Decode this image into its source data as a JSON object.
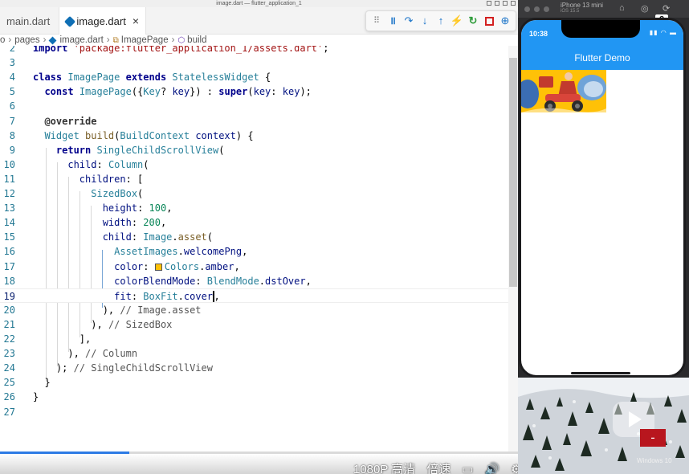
{
  "window": {
    "title": "image.dart — flutter_application_1"
  },
  "tabs": [
    {
      "label": "main.dart",
      "active": false
    },
    {
      "label": "image.dart",
      "active": true,
      "close_glyph": "×"
    }
  ],
  "breadcrumb": {
    "items": [
      "o",
      "pages",
      "image.dart",
      "ImagePage",
      "build"
    ],
    "separator": "›"
  },
  "debug_toolbar": {
    "icons": [
      "drag-handle-icon",
      "pause-icon",
      "step-over-icon",
      "step-into-icon",
      "step-out-icon",
      "hot-reload-icon",
      "restart-icon",
      "stop-icon",
      "devtools-icon"
    ]
  },
  "editor": {
    "current_line": 19,
    "lines": [
      {
        "n": "2",
        "tokens": [
          [
            "kw",
            "import "
          ],
          [
            "str",
            "'package:flutter_application_1/assets.dart'"
          ],
          [
            "plain",
            ";"
          ]
        ]
      },
      {
        "n": "3",
        "tokens": []
      },
      {
        "n": "4",
        "tokens": [
          [
            "kw",
            "class "
          ],
          [
            "type",
            "ImagePage "
          ],
          [
            "kw",
            "extends "
          ],
          [
            "type",
            "StatelessWidget "
          ],
          [
            "plain",
            "{"
          ]
        ]
      },
      {
        "n": "5",
        "tokens": [
          [
            "plain",
            "  "
          ],
          [
            "kw",
            "const "
          ],
          [
            "type",
            "ImagePage"
          ],
          [
            "plain",
            "({"
          ],
          [
            "type",
            "Key"
          ],
          [
            "plain",
            "? "
          ],
          [
            "prop",
            "key"
          ],
          [
            "plain",
            "}) : "
          ],
          [
            "kw",
            "super"
          ],
          [
            "plain",
            "("
          ],
          [
            "prop",
            "key"
          ],
          [
            "plain",
            ": "
          ],
          [
            "prop",
            "key"
          ],
          [
            "plain",
            ");"
          ]
        ]
      },
      {
        "n": "6",
        "tokens": []
      },
      {
        "n": "7",
        "tokens": [
          [
            "plain",
            "  "
          ],
          [
            "ann",
            "@override"
          ]
        ]
      },
      {
        "n": "8",
        "tokens": [
          [
            "plain",
            "  "
          ],
          [
            "type",
            "Widget "
          ],
          [
            "fn",
            "build"
          ],
          [
            "plain",
            "("
          ],
          [
            "type",
            "BuildContext "
          ],
          [
            "prop",
            "context"
          ],
          [
            "plain",
            ") {"
          ]
        ]
      },
      {
        "n": "9",
        "tokens": [
          [
            "plain",
            "    "
          ],
          [
            "kw",
            "return "
          ],
          [
            "type",
            "SingleChildScrollView"
          ],
          [
            "plain",
            "("
          ]
        ]
      },
      {
        "n": "10",
        "tokens": [
          [
            "plain",
            "      "
          ],
          [
            "prop",
            "child"
          ],
          [
            "plain",
            ": "
          ],
          [
            "type",
            "Column"
          ],
          [
            "plain",
            "("
          ]
        ]
      },
      {
        "n": "11",
        "tokens": [
          [
            "plain",
            "        "
          ],
          [
            "prop",
            "children"
          ],
          [
            "plain",
            ": ["
          ]
        ]
      },
      {
        "n": "12",
        "tokens": [
          [
            "plain",
            "          "
          ],
          [
            "type",
            "SizedBox"
          ],
          [
            "plain",
            "("
          ]
        ]
      },
      {
        "n": "13",
        "tokens": [
          [
            "plain",
            "            "
          ],
          [
            "prop",
            "height"
          ],
          [
            "plain",
            ": "
          ],
          [
            "num",
            "100"
          ],
          [
            "plain",
            ","
          ]
        ]
      },
      {
        "n": "14",
        "tokens": [
          [
            "plain",
            "            "
          ],
          [
            "prop",
            "width"
          ],
          [
            "plain",
            ": "
          ],
          [
            "num",
            "200"
          ],
          [
            "plain",
            ","
          ]
        ]
      },
      {
        "n": "15",
        "tokens": [
          [
            "plain",
            "            "
          ],
          [
            "prop",
            "child"
          ],
          [
            "plain",
            ": "
          ],
          [
            "type",
            "Image"
          ],
          [
            "plain",
            "."
          ],
          [
            "fn",
            "asset"
          ],
          [
            "plain",
            "("
          ]
        ]
      },
      {
        "n": "16",
        "tokens": [
          [
            "plain",
            "              "
          ],
          [
            "type",
            "AssetImages"
          ],
          [
            "plain",
            "."
          ],
          [
            "prop",
            "welcomePng"
          ],
          [
            "plain",
            ","
          ]
        ]
      },
      {
        "n": "17",
        "tokens": [
          [
            "plain",
            "              "
          ],
          [
            "prop",
            "color"
          ],
          [
            "plain",
            ": "
          ],
          [
            "swatch",
            ""
          ],
          [
            "type",
            "Colors"
          ],
          [
            "plain",
            "."
          ],
          [
            "prop",
            "amber"
          ],
          [
            "plain",
            ","
          ]
        ]
      },
      {
        "n": "18",
        "tokens": [
          [
            "plain",
            "              "
          ],
          [
            "prop",
            "colorBlendMode"
          ],
          [
            "plain",
            ": "
          ],
          [
            "type",
            "BlendMode"
          ],
          [
            "plain",
            "."
          ],
          [
            "prop",
            "dstOver"
          ],
          [
            "plain",
            ","
          ]
        ]
      },
      {
        "n": "19",
        "tokens": [
          [
            "plain",
            "              "
          ],
          [
            "prop",
            "fit"
          ],
          [
            "plain",
            ": "
          ],
          [
            "type",
            "BoxFit"
          ],
          [
            "plain",
            "."
          ],
          [
            "prop",
            "cover"
          ],
          [
            "cursor",
            ""
          ],
          [
            "plain",
            ","
          ]
        ]
      },
      {
        "n": "20",
        "tokens": [
          [
            "plain",
            "            "
          ],
          [
            "plain",
            "), "
          ],
          [
            "cmt",
            "// Image.asset"
          ]
        ]
      },
      {
        "n": "21",
        "tokens": [
          [
            "plain",
            "          "
          ],
          [
            "plain",
            "), "
          ],
          [
            "cmt",
            "// SizedBox"
          ]
        ]
      },
      {
        "n": "22",
        "tokens": [
          [
            "plain",
            "        "
          ],
          [
            "plain",
            "],"
          ]
        ]
      },
      {
        "n": "23",
        "tokens": [
          [
            "plain",
            "      "
          ],
          [
            "plain",
            "), "
          ],
          [
            "cmt",
            "// Column"
          ]
        ]
      },
      {
        "n": "24",
        "tokens": [
          [
            "plain",
            "    "
          ],
          [
            "plain",
            "); "
          ],
          [
            "cmt",
            "// SingleChildScrollView"
          ]
        ]
      },
      {
        "n": "25",
        "tokens": [
          [
            "plain",
            "  "
          ],
          [
            "plain",
            "}"
          ]
        ]
      },
      {
        "n": "26",
        "tokens": [
          [
            "plain",
            "}"
          ]
        ]
      },
      {
        "n": "27",
        "tokens": []
      }
    ]
  },
  "video": {
    "progress": 0.25,
    "controls": [
      "1080P 高清",
      "倍速"
    ],
    "control_icons": [
      "subtitle-icon",
      "volume-icon",
      "settings-icon",
      "pip-icon",
      "widescreen-icon",
      "webfullscreen-icon",
      "fullscreen-icon"
    ]
  },
  "simulator": {
    "device_name": "iPhone 13 mini",
    "device_os": "iOS 15.5",
    "help_badge": "?",
    "status_time": "10:38",
    "status_icons": "▮▮ ◠ ▬",
    "app_title": "Flutter Demo",
    "overlay_text": "Windows 10",
    "colors": {
      "app_bar": "#2196f3",
      "image_bg": "#ffc107"
    }
  }
}
